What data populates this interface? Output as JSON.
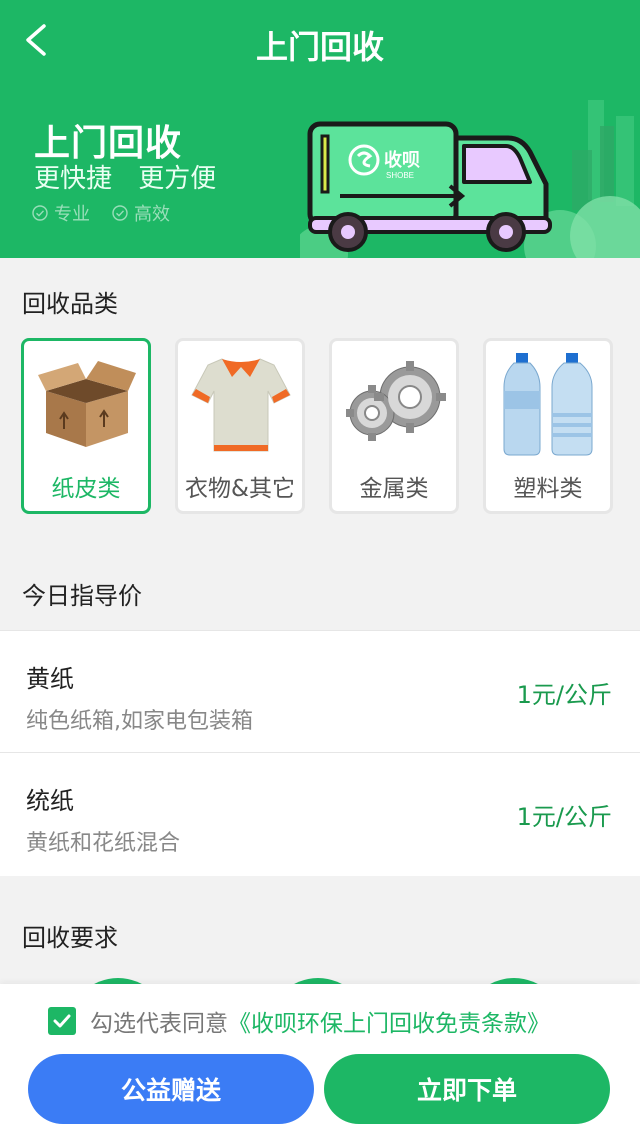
{
  "header": {
    "title": "上门回收"
  },
  "banner": {
    "title": "上门回收",
    "subtitle_1": "更快捷",
    "subtitle_2": "更方便",
    "tags": [
      "专业",
      "高效"
    ],
    "truck_brand": "收呗",
    "truck_brand_en": "SHOBE"
  },
  "categories": {
    "title": "回收品类",
    "items": [
      {
        "label": "纸皮类",
        "icon": "cardboard-box-icon",
        "selected": true
      },
      {
        "label": "衣物&其它",
        "icon": "shirt-icon",
        "selected": false
      },
      {
        "label": "金属类",
        "icon": "gears-icon",
        "selected": false
      },
      {
        "label": "塑料类",
        "icon": "plastic-bottles-icon",
        "selected": false
      }
    ]
  },
  "prices": {
    "title": "今日指导价",
    "rows": [
      {
        "name": "黄纸",
        "desc": "纯色纸箱,如家电包装箱",
        "price": "1元/公斤"
      },
      {
        "name": "统纸",
        "desc": "黄纸和花纸混合",
        "price": "1元/公斤"
      }
    ]
  },
  "requirements": {
    "title": "回收要求"
  },
  "footer": {
    "agree_text": "勾选代表同意",
    "agree_link": "《收呗环保上门回收免责条款》",
    "agreed": true,
    "donate_label": "公益赠送",
    "order_label": "立即下单"
  },
  "colors": {
    "primary": "#1db765",
    "blue": "#3b7cf5"
  }
}
